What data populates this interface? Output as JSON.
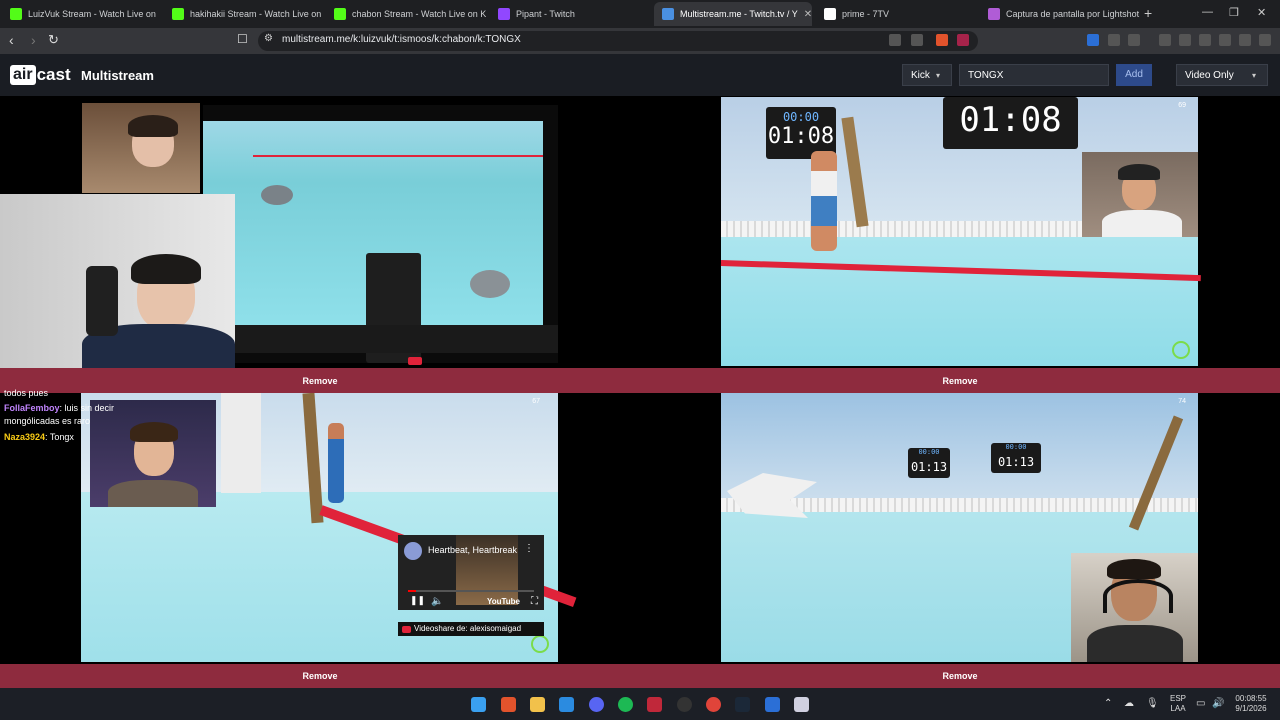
{
  "browser": {
    "tabs": [
      {
        "title": "LuizVuk Stream - Watch Live on",
        "icon_color": "#53fc18"
      },
      {
        "title": "hakihakii Stream - Watch Live on",
        "icon_color": "#53fc18"
      },
      {
        "title": "chabon Stream - Watch Live on K",
        "icon_color": "#53fc18"
      },
      {
        "title": "Pipant - Twitch",
        "icon_color": "#9147ff"
      },
      {
        "title": "Multistream.me - Twitch.tv / Y",
        "icon_color": "#4a90e2",
        "active": true
      },
      {
        "title": "prime - 7TV",
        "icon_color": "#ffffff"
      },
      {
        "title": "Captura de pantalla por Lightshot",
        "icon_color": "#b05cd6"
      }
    ],
    "url": "multistream.me/k:luizvuk/t:ismoos/k:chabon/k:TONGX"
  },
  "app": {
    "logo_part1": "air",
    "logo_part2": "cast",
    "title": "Multistream",
    "platform": "Kick",
    "channel_input": "TONGX",
    "add_label": "Add",
    "mode": "Video Only"
  },
  "streams": [
    {
      "remove_label": "Remove"
    },
    {
      "remove_label": "Remove",
      "timer_small": "00:00",
      "timer_big": "01:08",
      "timer2": "01:08",
      "viewers": "69"
    },
    {
      "remove_label": "Remove",
      "viewers": "67"
    },
    {
      "remove_label": "Remove",
      "timer_a_small": "00:00",
      "timer_a_big": "01:13",
      "timer_b_small": "00:00",
      "timer_b_big": "01:13",
      "viewers": "74"
    }
  ],
  "chat": [
    {
      "user": "",
      "text": "todos pues",
      "color": "#ffffff"
    },
    {
      "user": "FollaFemboy",
      "text": "luis sin decir",
      "color": "#c084fc"
    },
    {
      "user": "",
      "text": "mongólicadas es raro",
      "color": "#ffffff"
    },
    {
      "user": "Naza3924",
      "text": "Tongx",
      "color": "#facc15"
    }
  ],
  "youtube": {
    "title": "Heartbeat, Heartbreak",
    "logo": "YouTube",
    "videoshare": "Videoshare de: alexisomaigad"
  },
  "taskbar": {
    "lang_top": "ESP",
    "lang_bottom": "LAA",
    "time": "00:08:55",
    "date": "9/1/2026"
  }
}
